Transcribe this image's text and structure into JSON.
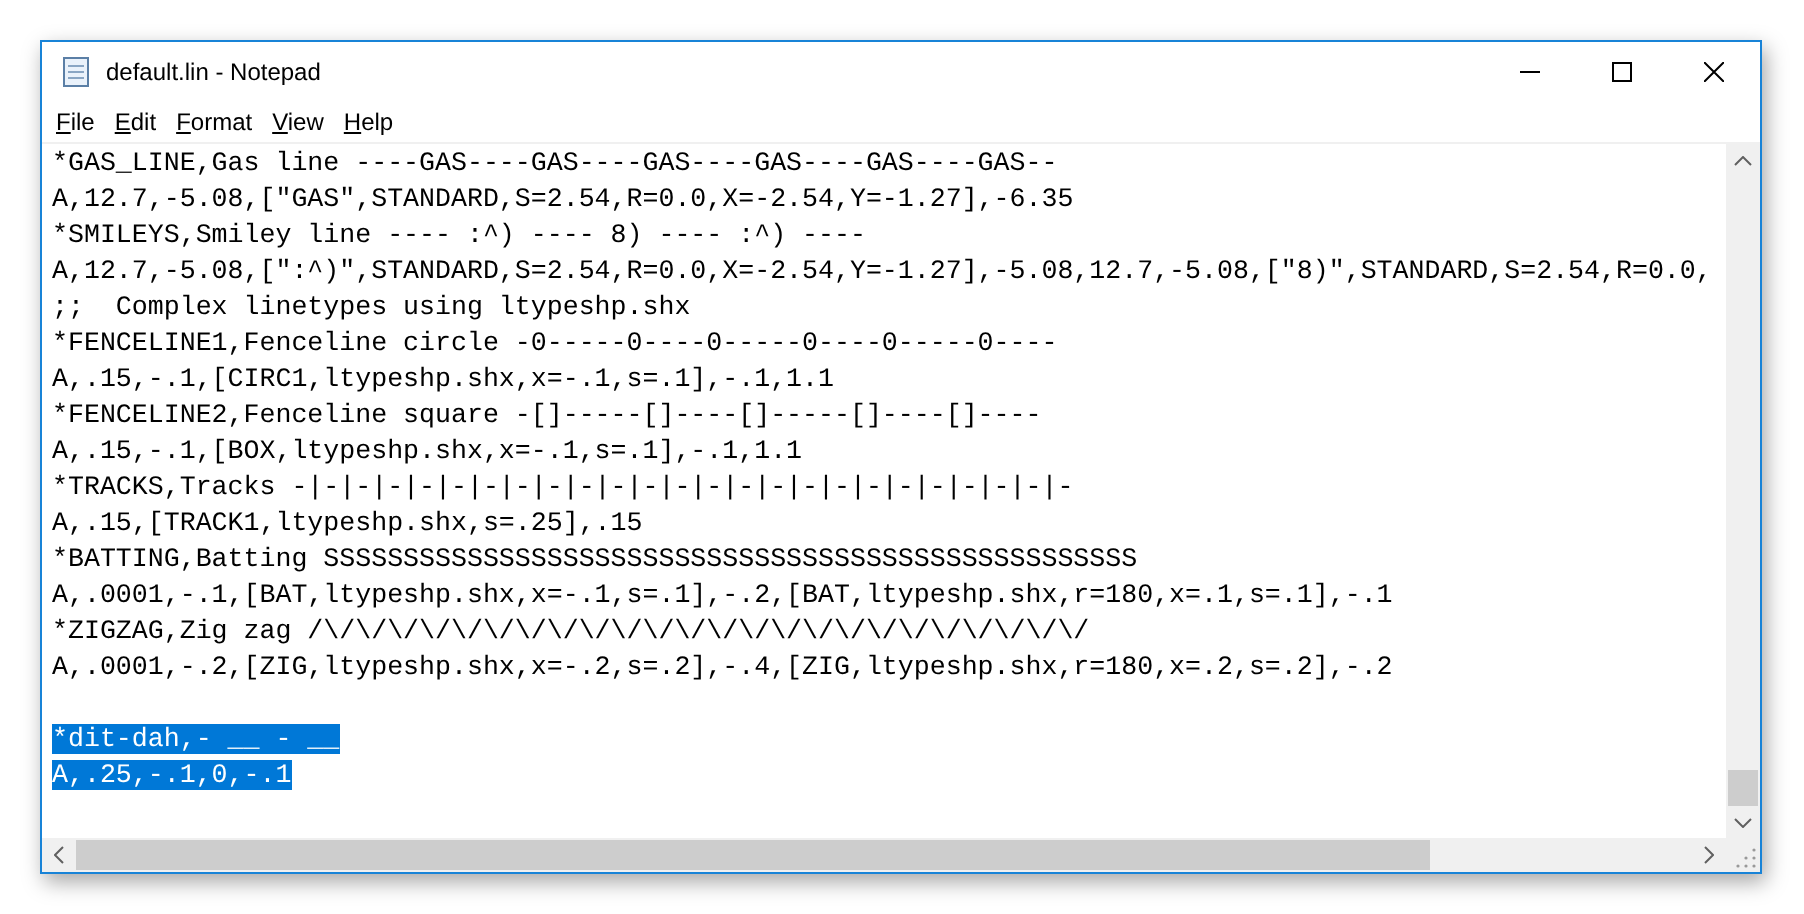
{
  "window": {
    "title": "default.lin - Notepad"
  },
  "menu": [
    {
      "label": "File"
    },
    {
      "label": "Edit"
    },
    {
      "label": "Format"
    },
    {
      "label": "View"
    },
    {
      "label": "Help"
    }
  ],
  "blocks": [
    {
      "selected": false,
      "lines": [
        "*GAS_LINE,Gas line ----GAS----GAS----GAS----GAS----GAS----GAS--",
        "A,12.7,-5.08,[\"GAS\",STANDARD,S=2.54,R=0.0,X=-2.54,Y=-1.27],-6.35",
        "*SMILEYS,Smiley line ---- :^) ---- 8) ---- :^) ----",
        "A,12.7,-5.08,[\":^)\",STANDARD,S=2.54,R=0.0,X=-2.54,Y=-1.27],-5.08,12.7,-5.08,[\"8)\",STANDARD,S=2.54,R=0.0,",
        ";;  Complex linetypes using ltypeshp.shx",
        "*FENCELINE1,Fenceline circle -0-----0----0-----0----0-----0----",
        "A,.15,-.1,[CIRC1,ltypeshp.shx,x=-.1,s=.1],-.1,1.1",
        "*FENCELINE2,Fenceline square -[]-----[]----[]-----[]----[]----",
        "A,.15,-.1,[BOX,ltypeshp.shx,x=-.1,s=.1],-.1,1.1",
        "*TRACKS,Tracks -|-|-|-|-|-|-|-|-|-|-|-|-|-|-|-|-|-|-|-|-|-|-|-|-",
        "A,.15,[TRACK1,ltypeshp.shx,s=.25],.15",
        "*BATTING,Batting SSSSSSSSSSSSSSSSSSSSSSSSSSSSSSSSSSSSSSSSSSSSSSSSSSS",
        "A,.0001,-.1,[BAT,ltypeshp.shx,x=-.1,s=.1],-.2,[BAT,ltypeshp.shx,r=180,x=.1,s=.1],-.1",
        "*ZIGZAG,Zig zag /\\/\\/\\/\\/\\/\\/\\/\\/\\/\\/\\/\\/\\/\\/\\/\\/\\/\\/\\/\\/\\/\\/\\/\\/",
        "A,.0001,-.2,[ZIG,ltypeshp.shx,x=-.2,s=.2],-.4,[ZIG,ltypeshp.shx,r=180,x=.2,s=.2],-.2"
      ]
    },
    {
      "selected": true,
      "lines": [
        "*dit-dah,- __ - __",
        "A,.25,-.1,0,-.1"
      ]
    }
  ]
}
